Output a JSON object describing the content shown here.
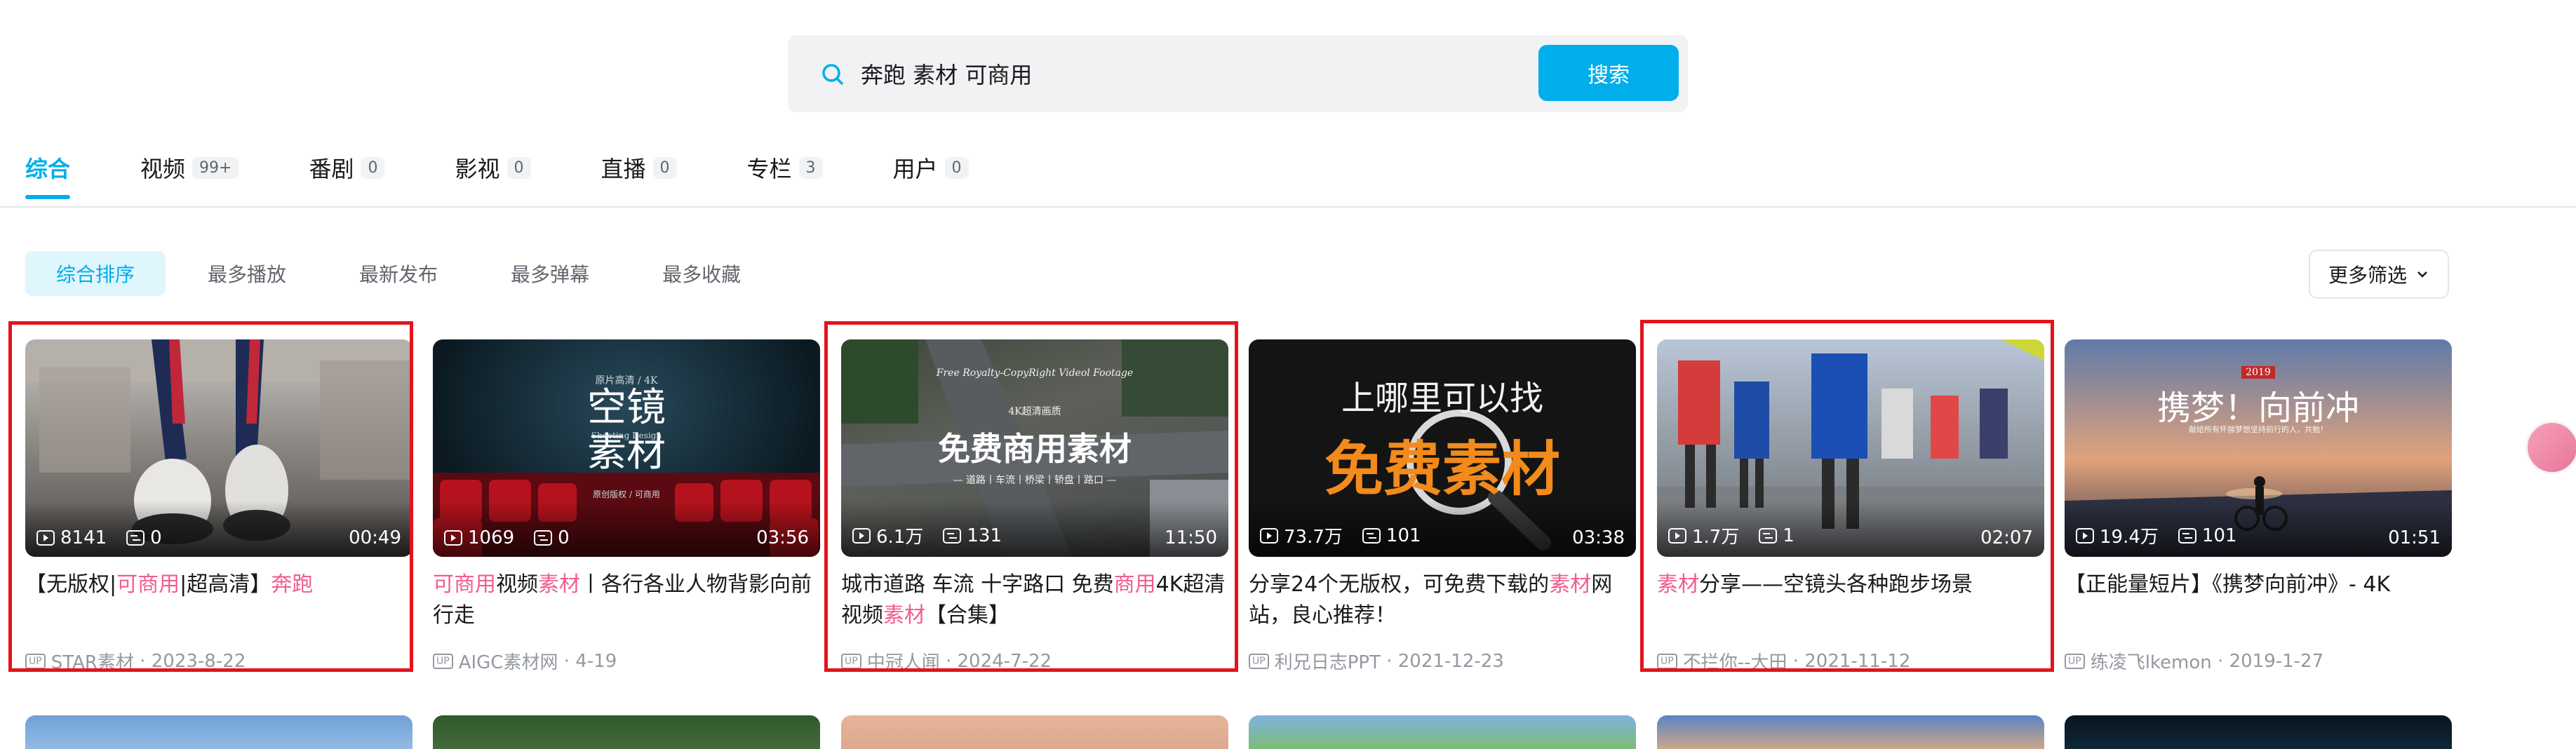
{
  "search": {
    "query": "奔跑 素材 可商用",
    "button_label": "搜索"
  },
  "tabs": [
    {
      "label": "综合",
      "count": ""
    },
    {
      "label": "视频",
      "count": "99+"
    },
    {
      "label": "番剧",
      "count": "0"
    },
    {
      "label": "影视",
      "count": "0"
    },
    {
      "label": "直播",
      "count": "0"
    },
    {
      "label": "专栏",
      "count": "3"
    },
    {
      "label": "用户",
      "count": "0"
    }
  ],
  "sort": [
    "综合排序",
    "最多播放",
    "最新发布",
    "最多弹幕",
    "最多收藏"
  ],
  "filter_label": "更多筛选",
  "cards": [
    {
      "plays": "8141",
      "danmaku": "0",
      "duration": "00:49",
      "title_parts": [
        "【无版权|",
        "可商用",
        "|超高清】",
        "奔跑"
      ],
      "uploader": "STAR素材",
      "date": "2023-8-22",
      "thumb_text": ""
    },
    {
      "plays": "1069",
      "danmaku": "0",
      "duration": "03:56",
      "title_parts": [
        "可商用",
        "视频",
        "素材",
        "丨各行各业人物背影向前行走"
      ],
      "uploader": "AIGC素材网",
      "date": "4-19",
      "thumb_text": "空镜\n素材",
      "thumb_sub": "原片高清 / 4K",
      "thumb_sub2": "Shooting Design",
      "thumb_sub3": "原创版权 / 可商用"
    },
    {
      "plays": "6.1万",
      "danmaku": "131",
      "duration": "11:50",
      "title_parts": [
        "城市道路 车流 十字路口 免费",
        "商用",
        "4K超清视频",
        "素材",
        "【合集】"
      ],
      "uploader": "中冠人闻",
      "date": "2024-7-22",
      "thumb_text": "免费商用素材",
      "thumb_sub": "4K超清画质",
      "thumb_sub2": "— 道路丨车流丨桥梁丨轿盘丨路口 —",
      "thumb_sub3": "Free Royalty-CopyRight Videol Footage"
    },
    {
      "plays": "73.7万",
      "danmaku": "101",
      "duration": "03:38",
      "title_parts": [
        "分享24个无版权，可免费下载的",
        "素材",
        "网站，良心推荐！"
      ],
      "uploader": "利兄日志PPT",
      "date": "2021-12-23",
      "thumb_text": "免费素材",
      "thumb_sub": "上哪里可以找"
    },
    {
      "plays": "1.7万",
      "danmaku": "1",
      "duration": "02:07",
      "title_parts": [
        "素材",
        "分享——空镜头各种跑步场景"
      ],
      "uploader": "不拦你--大田",
      "date": "2021-11-12",
      "thumb_text": ""
    },
    {
      "plays": "19.4万",
      "danmaku": "101",
      "duration": "01:51",
      "title_parts": [
        "【正能量短片】《携梦向前冲》- 4K"
      ],
      "uploader": "练凌飞lkemon",
      "date": "2019-1-27",
      "thumb_text": "携梦！向前冲",
      "thumb_sub": "2019",
      "thumb_sub2": "献给所有怀揣梦想坚持前行的人，共勉！"
    }
  ],
  "colors": {
    "accent": "#00aeec",
    "highlight": "#f25d8e",
    "annotation_box": "#e3141b"
  }
}
